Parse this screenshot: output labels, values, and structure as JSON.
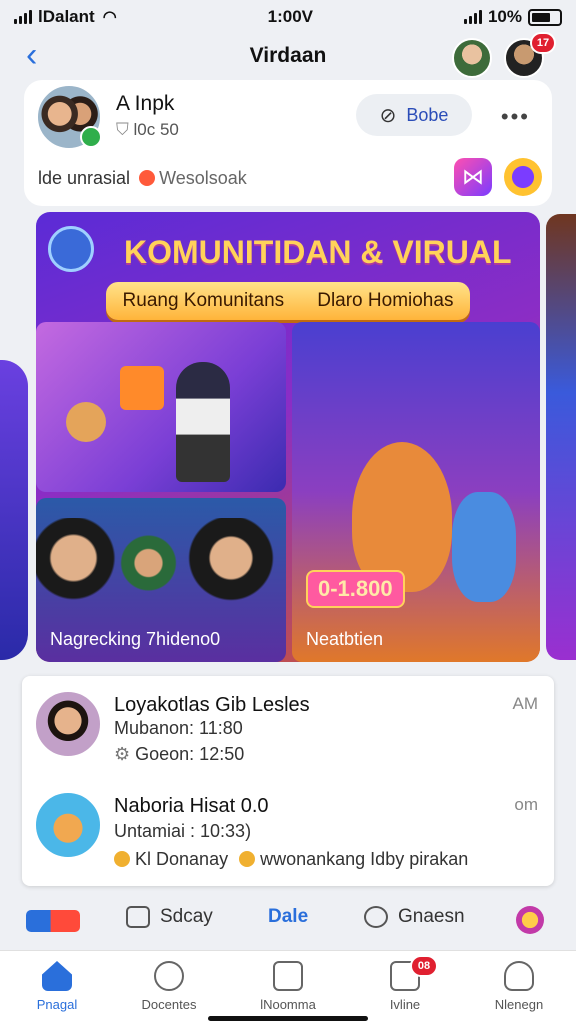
{
  "status": {
    "carrier": "lDalant",
    "time": "1:00V",
    "battery": "10%",
    "battery_level": 0.7
  },
  "header": {
    "title": "Virdaan",
    "back_icon": "chevron-left-icon",
    "notif_count": "17"
  },
  "profile": {
    "name": "A Inpk",
    "sub": "l0c 50",
    "button": "Bobe",
    "line": "lde unrasial",
    "line_tag": "Wesolsoak"
  },
  "banner": {
    "title": "KOMUNITIDAN & VIRUAL",
    "pill_left": "Ruang Komunitans",
    "pill_right": "Dlaro Homiohas",
    "tile1_caption": "Nagrecking 7hideno0",
    "tile2_caption": "Neatbtien",
    "price": "0-1.800"
  },
  "list": [
    {
      "name": "Loyakotlas Gib Lesles",
      "time": "AM",
      "line1": "Mubanon: 11:80",
      "line2": "Goeon: 12:50"
    },
    {
      "name": "Naboria Hisat 0.0",
      "time": "om",
      "line1": "Untamiai : 10:33)",
      "line2a": "Kl Donanay",
      "line2b": "wwonankang Idby pirakan"
    }
  ],
  "tabs": {
    "t1": "Sdcay",
    "t2": "Dale",
    "t3": "Gnaesn"
  },
  "nav": [
    {
      "label": "Pnagal"
    },
    {
      "label": "Docentes"
    },
    {
      "label": "lNoomma"
    },
    {
      "label": "Ivline",
      "badge": "08"
    },
    {
      "label": "Nlenegn"
    }
  ],
  "colors": {
    "accent": "#2a6fdb",
    "badge": "#e02030"
  }
}
